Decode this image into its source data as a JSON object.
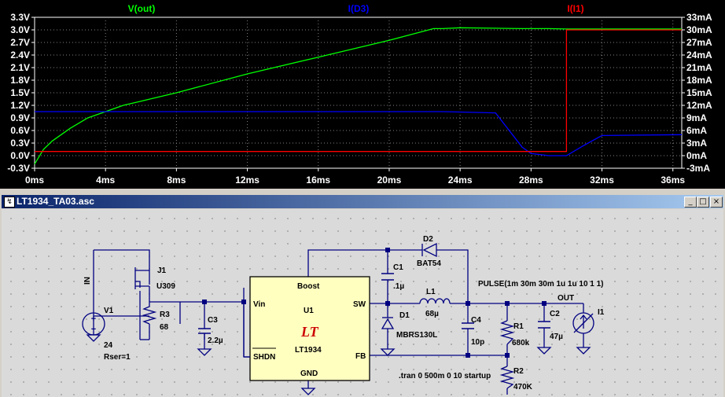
{
  "plot": {
    "traces": [
      {
        "name": "V(out)",
        "color": "#00ff00"
      },
      {
        "name": "I(D3)",
        "color": "#0000ff"
      },
      {
        "name": "I(I1)",
        "color": "#ff0000"
      }
    ],
    "x_labels": [
      "0ms",
      "4ms",
      "8ms",
      "12ms",
      "16ms",
      "20ms",
      "24ms",
      "28ms",
      "32ms",
      "36ms"
    ],
    "y_left_labels": [
      "3.3V",
      "3.0V",
      "2.7V",
      "2.4V",
      "2.1V",
      "1.8V",
      "1.5V",
      "1.2V",
      "0.9V",
      "0.6V",
      "0.3V",
      "0.0V",
      "-0.3V"
    ],
    "y_right_labels": [
      "33mA",
      "30mA",
      "27mA",
      "24mA",
      "21mA",
      "18mA",
      "15mA",
      "12mA",
      "9mA",
      "6mA",
      "3mA",
      "0mA",
      "-3mA"
    ]
  },
  "chart_data": {
    "type": "line",
    "x": [
      0,
      0.5,
      1,
      2,
      3,
      4,
      5,
      6,
      8,
      12,
      16,
      20,
      22.5,
      23,
      24,
      26,
      27.5,
      28,
      29,
      30,
      31,
      32,
      36.5
    ],
    "series": [
      {
        "name": "V(out)",
        "unit": "V",
        "values": [
          -0.2,
          0.15,
          0.35,
          0.65,
          0.9,
          1.05,
          1.2,
          1.3,
          1.5,
          1.95,
          2.35,
          2.75,
          3.03,
          3.03,
          3.05,
          3.04,
          3.03,
          3.03,
          3.03,
          3.02,
          3.02,
          3.02,
          3.02
        ]
      },
      {
        "name": "I(D3)",
        "unit": "mA",
        "values": [
          10.5,
          10.5,
          10.5,
          10.5,
          10.5,
          10.5,
          10.5,
          10.5,
          10.5,
          10.5,
          10.5,
          10.5,
          10.5,
          10.5,
          10.4,
          10.2,
          2.0,
          0.5,
          0,
          0,
          2.5,
          4.8,
          5.0
        ]
      },
      {
        "name": "I(I1)",
        "unit": "mA",
        "values": [
          1,
          1,
          1,
          1,
          1,
          1,
          1,
          1,
          1,
          1,
          1,
          1,
          1,
          1,
          1,
          1,
          1,
          1,
          1,
          30,
          30,
          30,
          30
        ]
      }
    ],
    "xlabel": "",
    "ylabel": "",
    "xlim": [
      0,
      36.5
    ],
    "ylim": [
      -0.3,
      3.3
    ],
    "y2lim": [
      -3,
      33
    ],
    "grid": true
  },
  "window": {
    "title": "LT1934_TA03.asc",
    "min_label": "_",
    "max_label": "□",
    "close_label": "×"
  },
  "schematic": {
    "labels": {
      "in": "IN",
      "v1": "V1",
      "v1_value": "24",
      "v1_rser": "Rser=1",
      "j1": "J1",
      "j1_model": "U309",
      "r3": "R3",
      "r3_value": "68",
      "c3": "C3",
      "c3_value": "2.2µ",
      "u1": "U1",
      "u1_part": "LT1934",
      "pin_boost": "Boost",
      "pin_vin": "Vin",
      "pin_sw": "SW",
      "pin_shdn": "SHDN",
      "pin_fb": "FB",
      "pin_gnd": "GND",
      "logo": "LT",
      "d2": "D2",
      "d2_model": "BAT54",
      "c1": "C1",
      "c1_value": ".1µ",
      "l1": "L1",
      "l1_value": "68µ",
      "d1": "D1",
      "d1_model": "MBRS130L",
      "c4": "C4",
      "c4_value": "10p",
      "r1": "R1",
      "r1_value": "680k",
      "c2": "C2",
      "c2_value": "47µ",
      "r2": "R2",
      "r2_value": "470K",
      "out": "OUT",
      "i1": "I1",
      "pulse": "PULSE(1m 30m 30m 1u 1u 10 1 1)",
      "tran": ".tran 0 500m 0 10 startup"
    }
  }
}
